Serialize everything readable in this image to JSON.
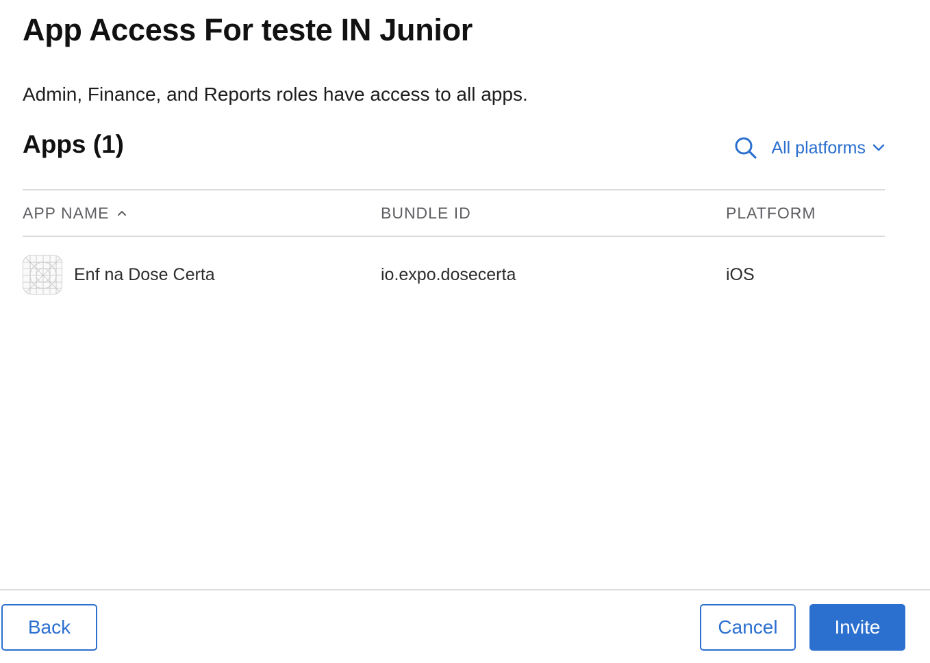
{
  "header": {
    "title": "App Access For teste IN Junior",
    "subtitle": "Admin, Finance, and Reports roles have access to all apps."
  },
  "apps_section": {
    "title": "Apps (1)",
    "platform_filter": "All platforms",
    "search_icon": "search-icon",
    "accent_color": "#2b6fcf"
  },
  "table": {
    "columns": {
      "app_name": "APP NAME",
      "bundle_id": "BUNDLE ID",
      "platform": "PLATFORM"
    },
    "sort": "ascending",
    "rows": [
      {
        "icon": "app-placeholder-icon",
        "app_name": "Enf na Dose Certa",
        "bundle_id": "io.expo.dosecerta",
        "platform": "iOS"
      }
    ]
  },
  "footer": {
    "back_label": "Back",
    "cancel_label": "Cancel",
    "invite_label": "Invite"
  }
}
